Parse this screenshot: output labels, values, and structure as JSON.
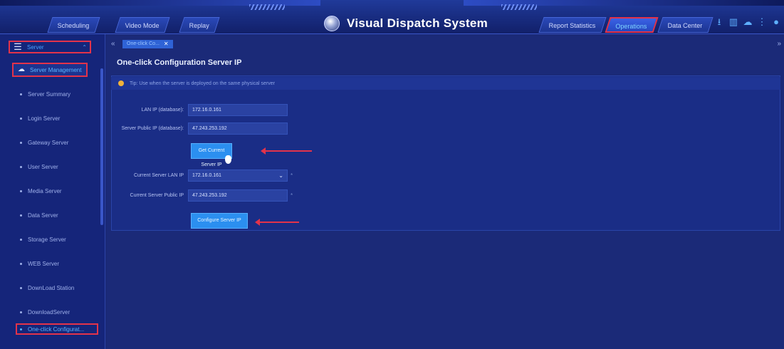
{
  "header": {
    "title": "Visual Dispatch System",
    "tabs_left": [
      "Scheduling",
      "Video Mode",
      "Replay"
    ],
    "tabs_right": [
      "Report Statistics",
      "Operations",
      "Data Center"
    ],
    "active_tab": "Operations",
    "right_icons": [
      "download-icon",
      "building-icon",
      "cloud-icon",
      "more-icon",
      "user-icon"
    ],
    "accent_color": "#e3334a"
  },
  "sidebar": {
    "root_label": "Server",
    "group_label": "Server Management",
    "items": [
      "Server Summary",
      "Login Server",
      "Gateway Server",
      "User Server",
      "Media Server",
      "Data Server",
      "Storage Server",
      "WEB Server",
      "DownLoad Station",
      "DownloadServer",
      "One-click Configurat..."
    ]
  },
  "content": {
    "open_tab": "One-click Co...",
    "page_title": "One-click Configuration Server IP",
    "tip": "Tip: Use when the server is deployed on the same physical server",
    "fields": {
      "lan_ip_label": "LAN IP (database):",
      "lan_ip_value": "172.16.0.161",
      "public_ip_label": "Server Public IP (database):",
      "public_ip_value": "47.243.253.192",
      "current_lan_label": "Current Server LAN IP",
      "current_lan_value": "172.16.0.161",
      "current_public_label": "Current Server Public IP",
      "current_public_value": "47.243.253.192"
    },
    "buttons": {
      "get_ip": "Get Current Server IP",
      "configure_ip": "Configure Server IP"
    }
  }
}
